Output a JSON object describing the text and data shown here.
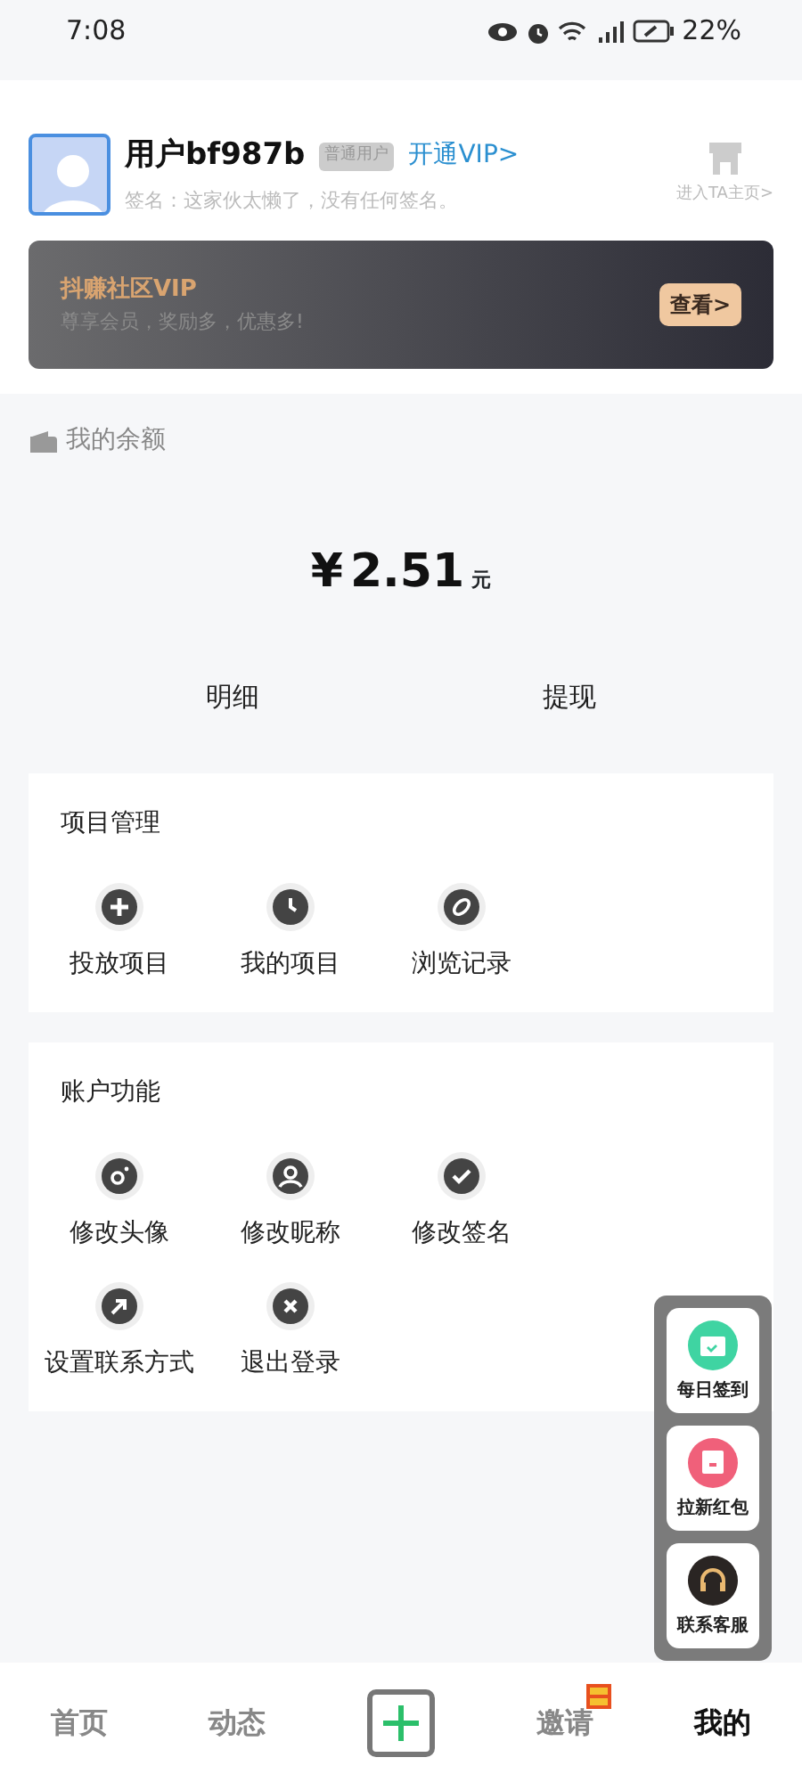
{
  "status_bar": {
    "time": "7:08",
    "battery": "22%"
  },
  "profile": {
    "username": "用户bf987b",
    "level_badge": "普通用户",
    "vip_link": "开通VIP>",
    "signature": "签名：这家伙太懒了，没有任何签名。",
    "homepage_link": "进入TA主页>"
  },
  "vip_banner": {
    "title": "抖赚社区VIP",
    "subtitle": "尊享会员，奖励多，优惠多!",
    "button": "查看>"
  },
  "balance": {
    "title": "我的余额",
    "currency": "¥",
    "amount": "2.51",
    "unit": "元",
    "actions": [
      "明细",
      "提现"
    ]
  },
  "sections": [
    {
      "title": "项目管理",
      "items": [
        {
          "label": "投放项目",
          "kind": "plus"
        },
        {
          "label": "我的项目",
          "kind": "clock"
        },
        {
          "label": "浏览记录",
          "kind": "compass"
        }
      ]
    },
    {
      "title": "账户功能",
      "items": [
        {
          "label": "修改头像",
          "kind": "camera"
        },
        {
          "label": "修改昵称",
          "kind": "person"
        },
        {
          "label": "修改签名",
          "kind": "check"
        },
        {
          "label": "设置联系方式",
          "kind": "arrow"
        },
        {
          "label": "退出登录",
          "kind": "close"
        }
      ]
    }
  ],
  "floating_menu": [
    {
      "label": "每日签到",
      "kind": "calendar",
      "color": "#3fd4a2"
    },
    {
      "label": "拉新红包",
      "kind": "gift",
      "color": "#f0607a"
    },
    {
      "label": "联系客服",
      "kind": "headset",
      "color": "#2a2523"
    }
  ],
  "bottom_nav": [
    {
      "label": "首页",
      "kind": "text",
      "selected": false,
      "badge": false
    },
    {
      "label": "动态",
      "kind": "text",
      "selected": false,
      "badge": false
    },
    {
      "kind": "add",
      "selected": false
    },
    {
      "label": "邀请",
      "kind": "text",
      "selected": false,
      "badge": true
    },
    {
      "label": "我的",
      "kind": "text",
      "selected": true,
      "badge": false
    }
  ]
}
